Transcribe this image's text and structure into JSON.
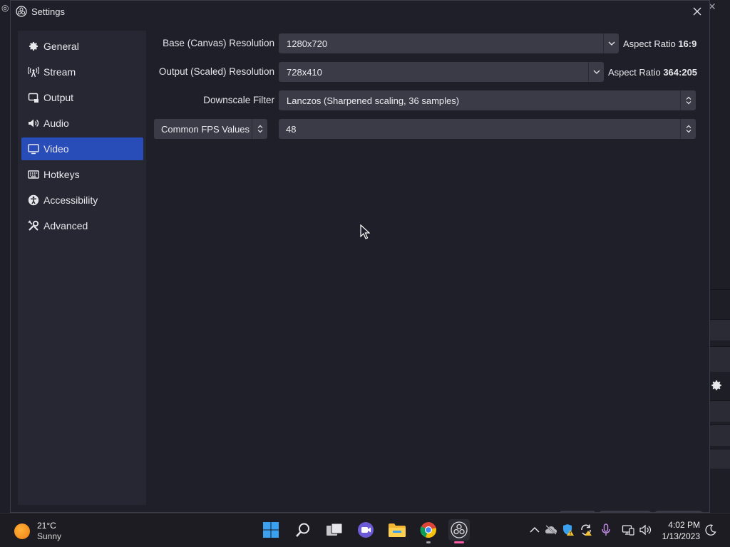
{
  "window": {
    "title": "Settings"
  },
  "sidebar": {
    "items": [
      {
        "label": "General",
        "icon": "gear-icon"
      },
      {
        "label": "Stream",
        "icon": "antenna-icon"
      },
      {
        "label": "Output",
        "icon": "output-icon"
      },
      {
        "label": "Audio",
        "icon": "speaker-icon"
      },
      {
        "label": "Video",
        "icon": "monitor-icon",
        "active": true
      },
      {
        "label": "Hotkeys",
        "icon": "keyboard-icon"
      },
      {
        "label": "Accessibility",
        "icon": "accessibility-icon"
      },
      {
        "label": "Advanced",
        "icon": "wrench-icon"
      }
    ]
  },
  "video": {
    "base_resolution": {
      "label": "Base (Canvas) Resolution",
      "value": "1280x720",
      "aspect_prefix": "Aspect Ratio",
      "aspect_value": "16:9"
    },
    "output_resolution": {
      "label": "Output (Scaled) Resolution",
      "value": "728x410",
      "aspect_prefix": "Aspect Ratio",
      "aspect_value": "364:205"
    },
    "downscale_filter": {
      "label": "Downscale Filter",
      "value": "Lanczos (Sharpened scaling, 36 samples)"
    },
    "fps": {
      "mode": "Common FPS Values",
      "value": "48"
    }
  },
  "taskbar": {
    "weather": {
      "temp": "21°C",
      "condition": "Sunny"
    },
    "clock": {
      "time": "4:02 PM",
      "date": "1/13/2023"
    }
  },
  "colors": {
    "accent": "#284cb8",
    "background": "#1e1f28",
    "sidebar": "#262733",
    "control": "#3a3b47"
  }
}
